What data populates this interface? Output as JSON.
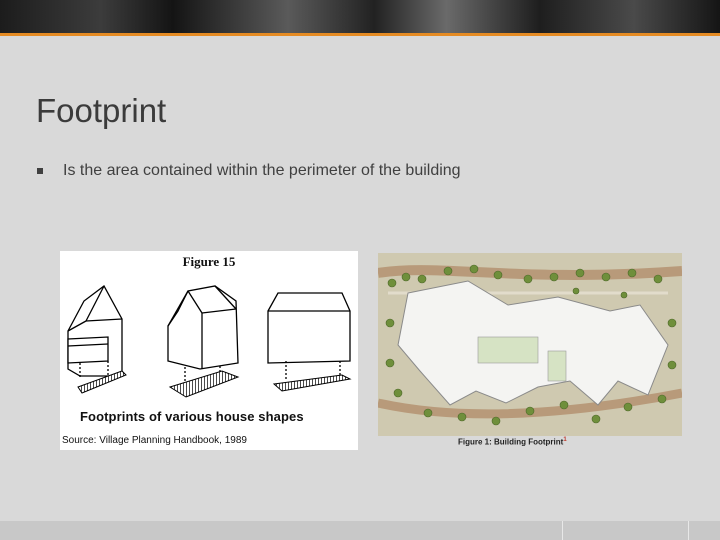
{
  "slide": {
    "title": "Footprint",
    "bullet": "Is the area contained within the perimeter of the building"
  },
  "figure15": {
    "title": "Figure 15",
    "caption": "Footprints of various house shapes",
    "source": "Source: Village Planning Handbook, 1989"
  },
  "site_plan": {
    "caption": "Figure 1: Building Footprint",
    "footnote_mark": "1"
  },
  "colors": {
    "accent": "#e58b23",
    "background": "#d9d9d9",
    "title": "#3b3b3b"
  }
}
